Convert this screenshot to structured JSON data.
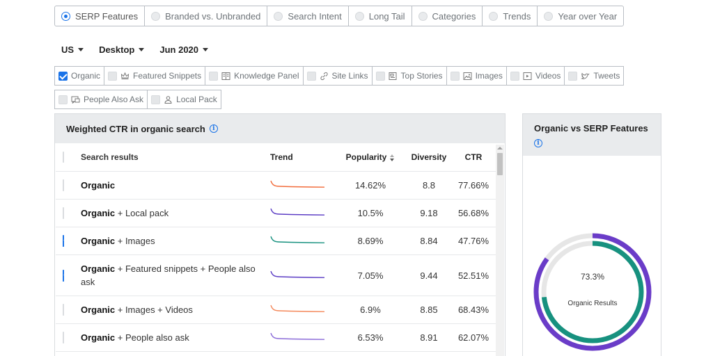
{
  "tabs": [
    {
      "label": "SERP Features",
      "selected": true
    },
    {
      "label": "Branded vs. Unbranded",
      "selected": false
    },
    {
      "label": "Search Intent",
      "selected": false
    },
    {
      "label": "Long Tail",
      "selected": false
    },
    {
      "label": "Categories",
      "selected": false
    },
    {
      "label": "Trends",
      "selected": false
    },
    {
      "label": "Year over Year",
      "selected": false
    }
  ],
  "filters": {
    "country": "US",
    "device": "Desktop",
    "date": "Jun 2020"
  },
  "features": [
    {
      "label": "Organic",
      "checked": true,
      "icon": "none"
    },
    {
      "label": "Featured Snippets",
      "checked": false,
      "icon": "crown-icon"
    },
    {
      "label": "Knowledge Panel",
      "checked": false,
      "icon": "panel-icon"
    },
    {
      "label": "Site Links",
      "checked": false,
      "icon": "link-icon"
    },
    {
      "label": "Top Stories",
      "checked": false,
      "icon": "news-icon"
    },
    {
      "label": "Images",
      "checked": false,
      "icon": "image-icon"
    },
    {
      "label": "Videos",
      "checked": false,
      "icon": "video-icon"
    },
    {
      "label": "Tweets",
      "checked": false,
      "icon": "bird-icon"
    },
    {
      "label": "People Also Ask",
      "checked": false,
      "icon": "question-icon"
    },
    {
      "label": "Local Pack",
      "checked": false,
      "icon": "person-pin-icon"
    }
  ],
  "main_panel": {
    "title": "Weighted CTR in organic search",
    "columns": {
      "search_results": "Search results",
      "trend": "Trend",
      "popularity": "Popularity",
      "diversity": "Diversity",
      "ctr": "CTR"
    },
    "rows": [
      {
        "base": "Organic",
        "extra": "",
        "checked": false,
        "trend_color": "#f26b3a",
        "popularity": "14.62%",
        "diversity": "8.8",
        "ctr": "77.66%"
      },
      {
        "base": "Organic",
        "extra": " + Local pack",
        "checked": false,
        "trend_color": "#5b3cc4",
        "popularity": "10.5%",
        "diversity": "9.18",
        "ctr": "56.68%"
      },
      {
        "base": "Organic",
        "extra": " + Images",
        "checked": true,
        "trend_color": "#17917f",
        "popularity": "8.69%",
        "diversity": "8.84",
        "ctr": "47.76%"
      },
      {
        "base": "Organic",
        "extra": " + Featured snippets + People also ask",
        "checked": true,
        "trend_color": "#5b3cc4",
        "popularity": "7.05%",
        "diversity": "9.44",
        "ctr": "52.51%"
      },
      {
        "base": "Organic",
        "extra": " + Images + Videos",
        "checked": false,
        "trend_color": "#f4885a",
        "popularity": "6.9%",
        "diversity": "8.85",
        "ctr": "68.43%"
      },
      {
        "base": "Organic",
        "extra": " + People also ask",
        "checked": false,
        "trend_color": "#8a6ad8",
        "popularity": "6.53%",
        "diversity": "8.91",
        "ctr": "62.07%"
      }
    ]
  },
  "side_panel": {
    "title": "Organic vs SERP Features",
    "donut": {
      "value_label": "73.3%",
      "caption": "Organic Results",
      "inner_fraction": 0.733,
      "outer_fraction": 0.85,
      "inner_color": "#17917f",
      "outer_color": "#6a3cc8",
      "track_color": "#e6e6e6"
    }
  }
}
